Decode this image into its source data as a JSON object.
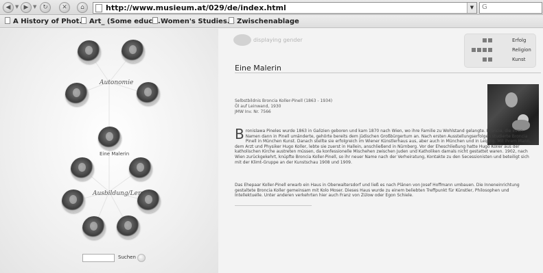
{
  "browser": {
    "url": "http://www.musieum.at/029/de/index.html",
    "search_placeholder": "G"
  },
  "bookmarks": [
    {
      "label": "A History of Phot..."
    },
    {
      "label": "Art_ (Some educ..."
    },
    {
      "label": "Women's Studies..."
    },
    {
      "label": "Zwischenablage"
    }
  ],
  "site": {
    "logo_text": "displaying gender",
    "menu": [
      {
        "label": "Erfolg",
        "squares": 2
      },
      {
        "label": "Religion",
        "squares": 4
      },
      {
        "label": "Kunst",
        "squares": 2
      }
    ]
  },
  "navigation": {
    "group_top_label": "Autonomie",
    "group_bottom_label": "Ausbildung/Lernen",
    "center_label": "Eine Malerin",
    "search_button_label": "Suchen"
  },
  "article": {
    "title": "Eine Malerin",
    "caption_lines": [
      "Selbstbildnis Broncia Koller-Pinell (1863 - 1934)",
      "Öl auf Leinwand, 1930",
      "JMW Inv. Nr. 7566"
    ],
    "dropcap": "B",
    "paragraph1": "ronislawa Pineles wurde 1863 in Galizien geboren und kam 1870 nach Wien, wo ihre Familie zu Wohlstand gelangte. Broncia, die ihren Namen dann in Pinell umänderte, gehörte bereits dem jüdischen Großbürgertum an. Nach ersten Ausstellungserfolgen studierte Broncia Pinell in München Kunst. Danach stellte sie erfolgreich im Wiener Künstlerhaus aus, aber auch in München und in Leipzig. Mit ihrem Mann, dem Arzt und Physiker Hugo Koller, lebte sie zuerst in Hallein, anschließend in Nürnberg. Vor der Eheschließung hatte Hugo Koller aus der katholischen Kirche austreten müssen, da konfessionelle Mischehen zwischen Juden und Katholiken damals nicht gestattet waren. 1902, nach Wien zurückgekehrt, knüpfte Broncia Koller-Pinell, so ihr neuer Name nach der Verheiratung, Kontakte zu den Secessionisten und beteiligt sich mit der Klimt-Gruppe an der Kunstschau 1908 und 1909.",
    "paragraph2": "Das Ehepaar Koller-Pinell erwarb ein Haus in Oberwaltersdorf und ließ es nach Plänen von Josef Hoffmann umbauen. Die Inneneinrichtung gestaltete Broncia Koller gemeinsam mit Kolo Moser. Dieses Haus wurde zu einem beliebten Treffpunkt für Künstler, Philosophen und Intellektuelle. Unter anderen verkehrten hier auch Franz von Zülow oder Egon Schiele."
  }
}
